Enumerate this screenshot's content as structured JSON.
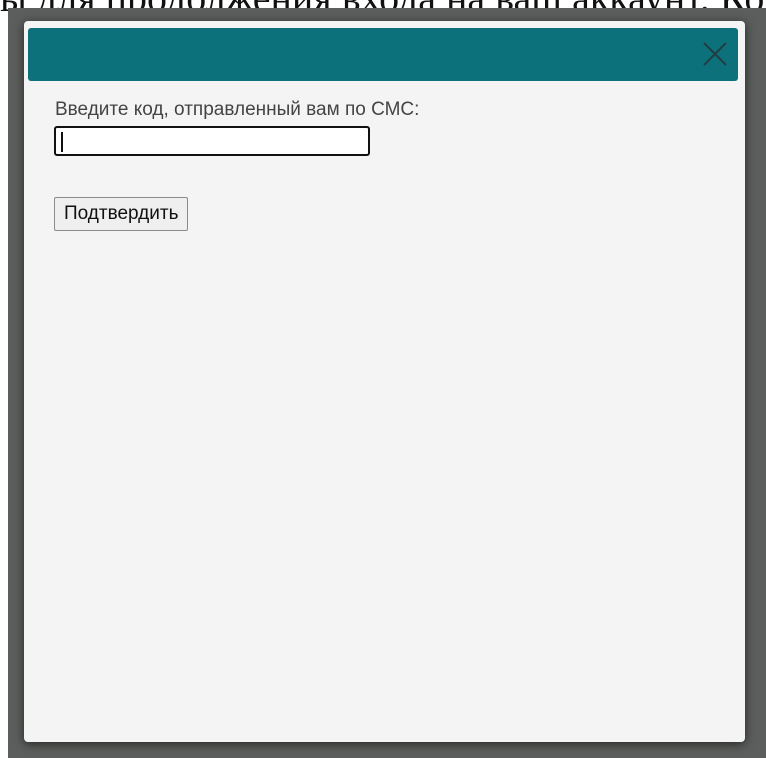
{
  "background": {
    "partial_text": "ы для продолжения входа на ваш аккаунт. Код отправлен"
  },
  "dialog": {
    "close_icon": "close-icon",
    "prompt": "Введите код, отправленный вам по СМС:",
    "code_input": {
      "value": "",
      "placeholder": ""
    },
    "confirm_label": "Подтвердить"
  },
  "colors": {
    "titlebar": "#0c717a",
    "overlay": "#5b5e5c",
    "dialog_background": "#f4f4f4",
    "close_icon": "#1f3f44"
  }
}
